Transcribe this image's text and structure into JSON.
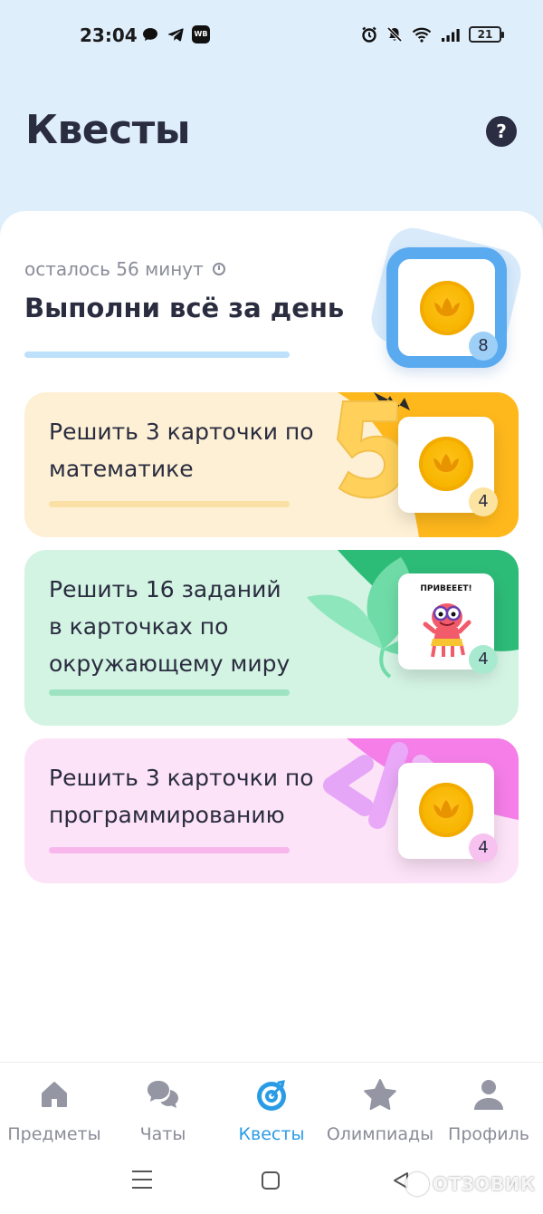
{
  "status_bar": {
    "time": "23:04",
    "left_icons": [
      "chat-bubble-icon",
      "telegram-icon",
      "wb-app-icon"
    ],
    "wb_label": "WB",
    "right_icons": [
      "alarm-icon",
      "mute-icon",
      "wifi-icon",
      "signal-icon"
    ],
    "battery": "21"
  },
  "header": {
    "title": "Квесты",
    "help_label": "?"
  },
  "daily_quest": {
    "time_left": "осталось 56 минут",
    "title": "Выполни всё за день",
    "reward_count": "8",
    "progress": 0,
    "accent_color": "#5aaaf0"
  },
  "quests": [
    {
      "text_lines": [
        "Решить 3 карточки по",
        "математике"
      ],
      "reward_count": "4",
      "reward_type": "coin",
      "progress": 0,
      "bg_color": "#fdf0d5",
      "bar_color": "#fbe0a6",
      "badge_color": "#fde3a0",
      "decor": "number-five"
    },
    {
      "text_lines": [
        "Решить 16 заданий",
        "в карточках по",
        "окружающему миру"
      ],
      "reward_count": "4",
      "reward_type": "sticker",
      "sticker_text": "ПРИВЕЕЕТ!",
      "progress": 0,
      "bg_color": "#d3f3e3",
      "bar_color": "#9ee3c1",
      "badge_color": "#a8ead0",
      "decor": "leaves"
    },
    {
      "text_lines": [
        "Решить 3 карточки по",
        "программированию"
      ],
      "reward_count": "4",
      "reward_type": "coin",
      "progress": 0,
      "bg_color": "#fde3f8",
      "bar_color": "#f8b7ec",
      "badge_color": "#f7c2f0",
      "decor": "code-brackets"
    }
  ],
  "bottom_nav": [
    {
      "label": "Предметы",
      "icon": "home-icon",
      "active": false
    },
    {
      "label": "Чаты",
      "icon": "chats-icon",
      "active": false
    },
    {
      "label": "Квесты",
      "icon": "target-icon",
      "active": true
    },
    {
      "label": "Олимпиады",
      "icon": "star-icon",
      "active": false
    },
    {
      "label": "Профиль",
      "icon": "profile-icon",
      "active": false
    }
  ],
  "watermark": "ОТЗОВИК"
}
